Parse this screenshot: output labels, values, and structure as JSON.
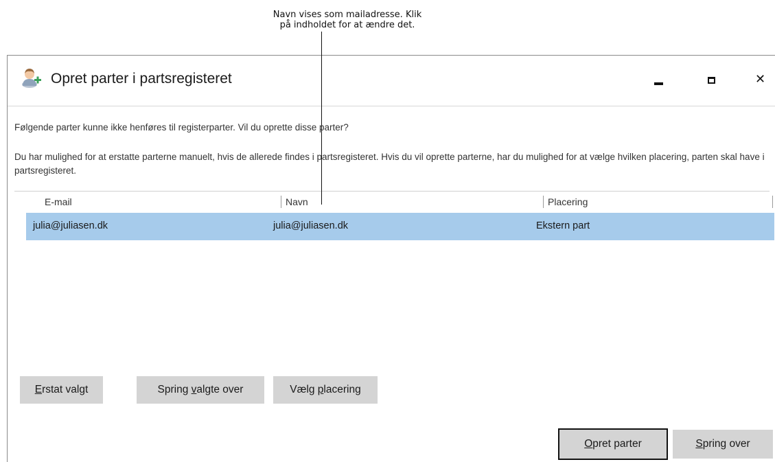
{
  "annotation": {
    "line1": "Navn vises som mailadresse. Klik",
    "line2": "på indholdet for at ændre det."
  },
  "window": {
    "title": "Opret parter i partsregisteret",
    "icon": "user-add-icon",
    "controls": {
      "minimize": "minimize-icon",
      "maximize": "maximize-icon",
      "close": "close-icon"
    }
  },
  "message": {
    "line1": "Følgende parter kunne ikke henføres til registerparter. Vil du oprette disse parter?",
    "line2": "Du har mulighed for at erstatte parterne manuelt, hvis de allerede findes i partsregisteret. Hvis du vil oprette parterne, har du mulighed for at vælge hvilken placering, parten skal have i partsregisteret."
  },
  "table": {
    "columns": [
      "E-mail",
      "Navn",
      "Placering"
    ],
    "rows": [
      {
        "email": "julia@juliasen.dk",
        "name": "julia@juliasen.dk",
        "placement": "Ekstern part"
      }
    ]
  },
  "buttons": {
    "replace": {
      "accel": "E",
      "rest": "rstat valgt"
    },
    "skip_selected": {
      "pre": "Spring ",
      "accel": "v",
      "rest": "algte over"
    },
    "choose_placement": {
      "pre": "Vælg ",
      "accel": "p",
      "rest": "lacering"
    },
    "create": {
      "accel": "O",
      "rest": "pret parter"
    },
    "skip": {
      "accel": "S",
      "rest": "pring over"
    }
  },
  "colors": {
    "selected_row": "#a6cbeb",
    "button_bg": "#d4d4d4"
  }
}
